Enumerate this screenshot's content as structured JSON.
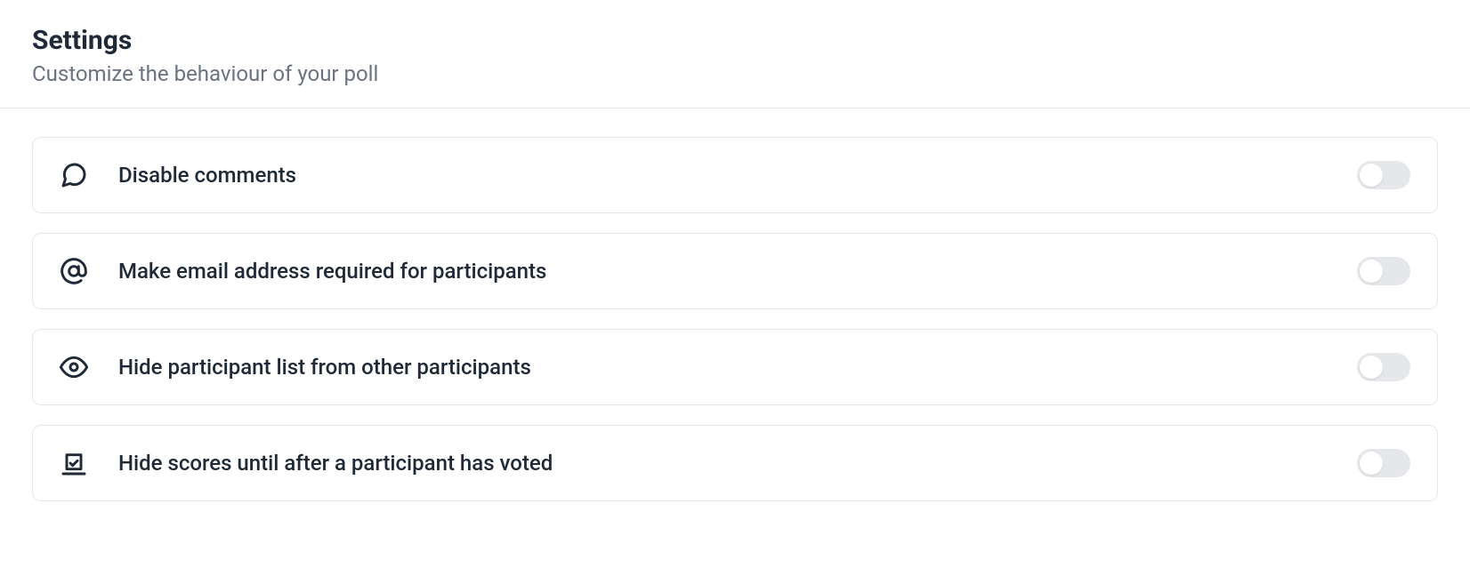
{
  "header": {
    "title": "Settings",
    "subtitle": "Customize the behaviour of your poll"
  },
  "settings": [
    {
      "icon": "message-circle-icon",
      "label": "Disable comments",
      "enabled": false
    },
    {
      "icon": "at-sign-icon",
      "label": "Make email address required for participants",
      "enabled": false
    },
    {
      "icon": "eye-icon",
      "label": "Hide participant list from other participants",
      "enabled": false
    },
    {
      "icon": "vote-icon",
      "label": "Hide scores until after a participant has voted",
      "enabled": false
    }
  ]
}
